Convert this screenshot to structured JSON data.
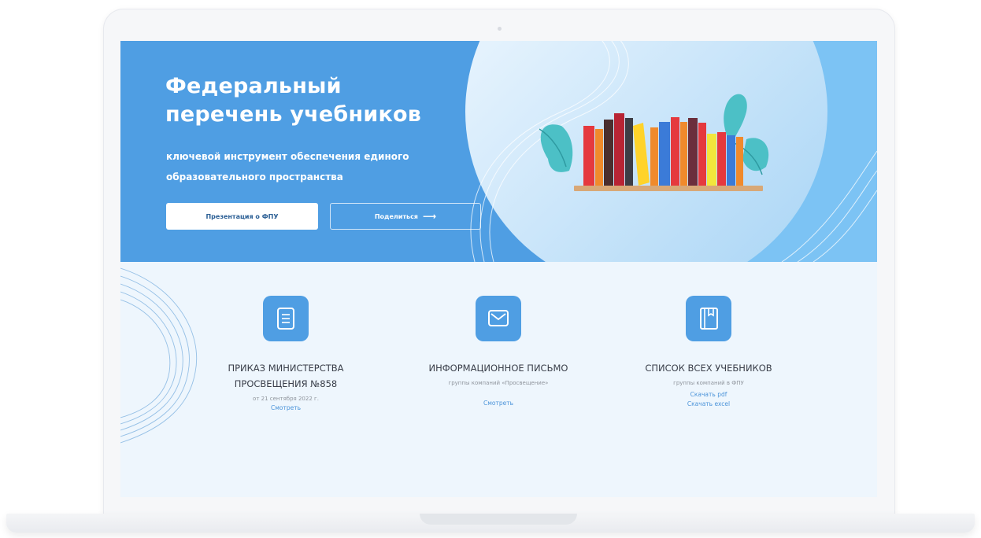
{
  "hero": {
    "title_line1": "Федеральный",
    "title_line2": "перечень учебников",
    "subtitle_line1": "ключевой инструмент обеспечения единого",
    "subtitle_line2": "образовательного пространства",
    "presentation_button": "Презентация о ФПУ",
    "share_button": "Поделиться",
    "share_icon": "arrow-right-icon",
    "illustration": "bookshelf-illustration"
  },
  "cards": [
    {
      "icon": "document-icon",
      "title_line1": "ПРИКАЗ МИНИСТЕРСТВА",
      "title_line2": "ПРОСВЕЩЕНИЯ №858",
      "meta": "от 21 сентября 2022 г.",
      "links": [
        "Смотреть"
      ]
    },
    {
      "icon": "envelope-icon",
      "title_line1": "ИНФОРМАЦИОННОЕ ПИСЬМО",
      "title_line2": "",
      "meta": "группы компаний «Просвещение»",
      "links": [
        "Смотреть"
      ]
    },
    {
      "icon": "book-icon",
      "title_line1": "СПИСОК ВСЕХ УЧЕБНИКОВ",
      "title_line2": "",
      "meta": "группы компаний в ФПУ",
      "links": [
        "Скачать pdf",
        "Скачать excel"
      ]
    }
  ],
  "colors": {
    "hero_blue": "#4f9ee3",
    "light_bg": "#eef6fd",
    "link": "#4a93d9"
  }
}
